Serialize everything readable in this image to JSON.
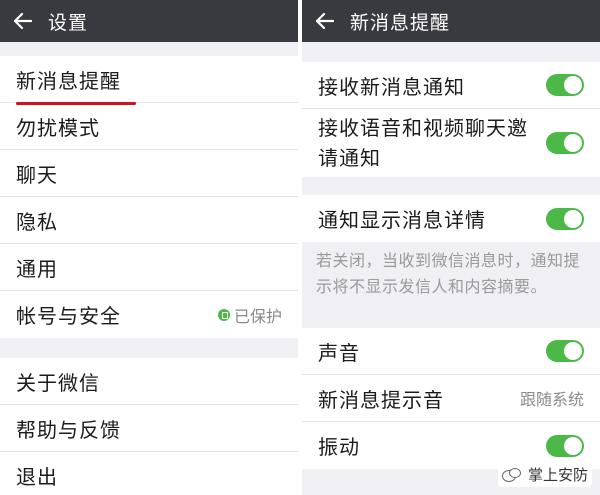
{
  "left": {
    "title": "设置",
    "groups": [
      [
        "新消息提醒",
        "勿扰模式",
        "聊天",
        "隐私",
        "通用",
        "帐号与安全"
      ],
      [
        "关于微信",
        "帮助与反馈",
        "退出"
      ]
    ],
    "account_status": "已保护"
  },
  "right": {
    "title": "新消息提醒",
    "section1": {
      "receive_new": "接收新消息通知",
      "receive_voice_video": "接收语音和视频聊天邀请通知"
    },
    "section2": {
      "show_details": "通知显示消息详情",
      "description": "若关闭，当收到微信消息时，通知提示将不显示发信人和内容摘要。"
    },
    "section3": {
      "sound": "声音",
      "ringtone": "新消息提示音",
      "ringtone_value": "跟随系统",
      "vibrate": "振动"
    }
  },
  "toggles": {
    "receive_new": true,
    "receive_voice_video": true,
    "show_details": true,
    "sound": true,
    "vibrate": true
  },
  "colors": {
    "topbar": "#393a3f",
    "toggle_on": "#4cb848",
    "highlight_underline": "#d0121d"
  },
  "watermark": "掌上安防"
}
